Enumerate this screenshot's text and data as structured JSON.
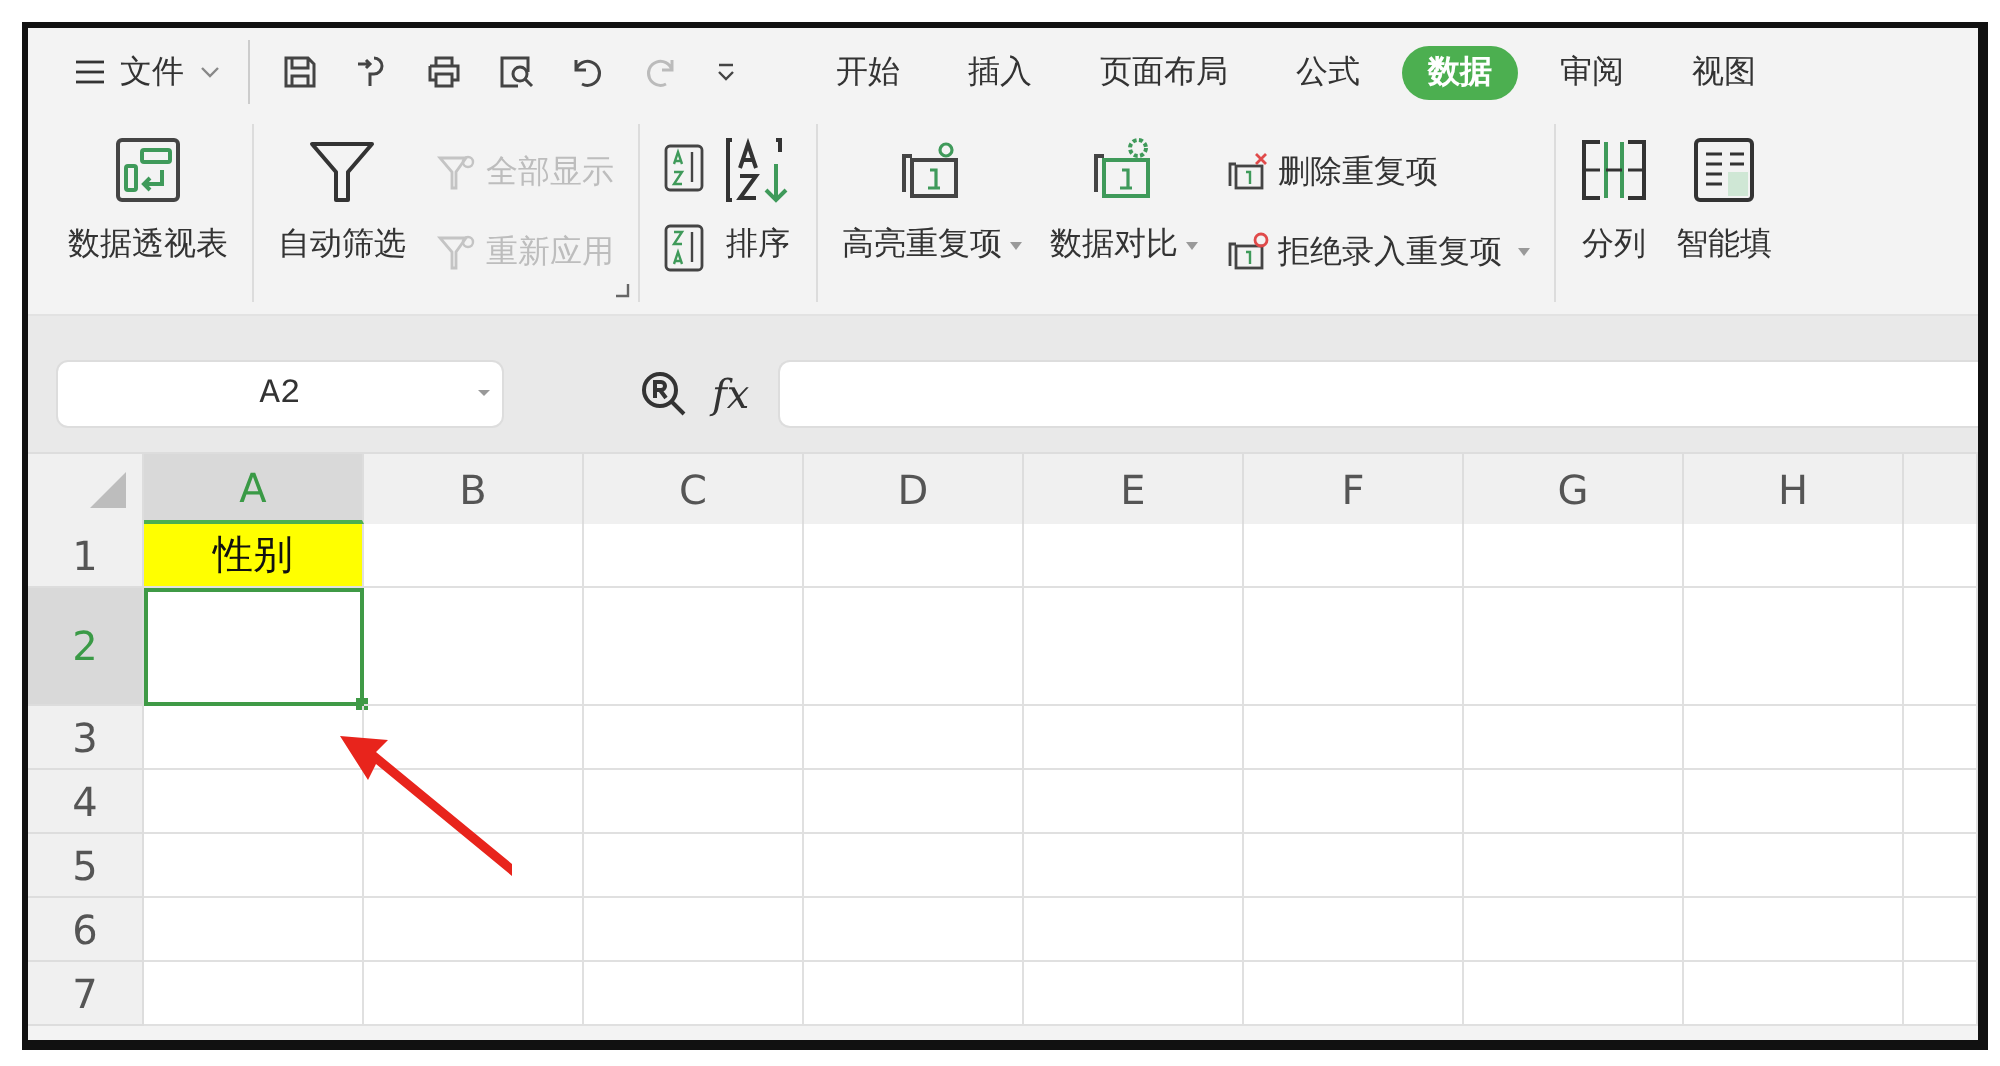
{
  "menu": {
    "file_label": "文件",
    "tabs": [
      {
        "label": "开始",
        "selected": false
      },
      {
        "label": "插入",
        "selected": false
      },
      {
        "label": "页面布局",
        "selected": false
      },
      {
        "label": "公式",
        "selected": false
      },
      {
        "label": "数据",
        "selected": true
      },
      {
        "label": "审阅",
        "selected": false
      },
      {
        "label": "视图",
        "selected": false
      }
    ]
  },
  "ribbon": [
    {
      "kind": "large",
      "label": "数据透视表",
      "disabled": false,
      "dropdown": false
    },
    {
      "kind": "large",
      "label": "自动筛选",
      "disabled": false,
      "dropdown": false
    },
    {
      "kind": "small",
      "label": "全部显示",
      "disabled": true,
      "dropdown": false
    },
    {
      "kind": "small",
      "label": "重新应用",
      "disabled": true,
      "dropdown": false
    },
    {
      "kind": "large",
      "label": "排序",
      "disabled": false,
      "dropdown": false
    },
    {
      "kind": "large",
      "label": "高亮重复项",
      "disabled": false,
      "dropdown": true
    },
    {
      "kind": "large",
      "label": "数据对比",
      "disabled": false,
      "dropdown": true
    },
    {
      "kind": "small",
      "label": "删除重复项",
      "disabled": false,
      "dropdown": false
    },
    {
      "kind": "small",
      "label": "拒绝录入重复项",
      "disabled": false,
      "dropdown": true
    },
    {
      "kind": "large",
      "label": "分列",
      "disabled": false,
      "dropdown": false
    },
    {
      "kind": "large",
      "label": "智能填",
      "disabled": false,
      "dropdown": false
    }
  ],
  "name_box": {
    "value": "A2"
  },
  "formula_label": "fx",
  "columns": [
    {
      "label": "A",
      "selected": true
    },
    {
      "label": "B",
      "selected": false
    },
    {
      "label": "C",
      "selected": false
    },
    {
      "label": "D",
      "selected": false
    },
    {
      "label": "E",
      "selected": false
    },
    {
      "label": "F",
      "selected": false
    },
    {
      "label": "G",
      "selected": false
    },
    {
      "label": "H",
      "selected": false
    }
  ],
  "rows": [
    {
      "label": "1",
      "selected": false,
      "a_cell": {
        "value": "性别",
        "highlighted": true,
        "active": false
      }
    },
    {
      "label": "2",
      "selected": true,
      "a_cell": {
        "highlighted": false,
        "active": true
      }
    },
    {
      "label": "3",
      "selected": false
    },
    {
      "label": "4",
      "selected": false
    },
    {
      "label": "5",
      "selected": false
    },
    {
      "label": "6",
      "selected": false
    },
    {
      "label": "7",
      "selected": false
    }
  ]
}
